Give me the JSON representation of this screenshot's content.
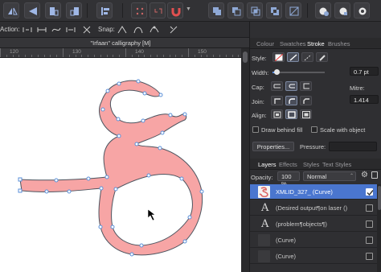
{
  "document": {
    "title": "\"Irfaan\" calligraphy [M]"
  },
  "context_toolbar": {
    "action_label": "Action:",
    "snap_label": "Snap:"
  },
  "ruler": {
    "labels": [
      "120",
      "130",
      "140",
      "150"
    ]
  },
  "panel": {
    "tabs": [
      "Colour",
      "Swatches",
      "Stroke",
      "Brushes"
    ],
    "active_tab": "Stroke",
    "style_label": "Style:",
    "width_label": "Width:",
    "width_value": "0.7 pt",
    "width_fraction": 0.08,
    "cap_label": "Cap:",
    "join_label": "Join:",
    "mitre_label": "Mitre:",
    "mitre_value": "1.414",
    "align_label": "Align:",
    "draw_behind_fill": "Draw behind fill",
    "scale_with_object": "Scale with object",
    "properties_button": "Properties...",
    "pressure_label": "Pressure:"
  },
  "layers_panel": {
    "tabs": [
      "Layers",
      "Effects",
      "Styles",
      "Text Styles"
    ],
    "active_tab": "Layers",
    "opacity_label": "Opacity:",
    "opacity_value": "100 %",
    "blend_mode": "Normal",
    "rows": [
      {
        "name": "XMLID_327_ (Curve)",
        "selected": true,
        "icon": "curve-thumb",
        "checked": true
      },
      {
        "name": "(Desired output¶on laser ()",
        "selected": false,
        "icon": "text-A",
        "checked": false
      },
      {
        "name": "(problem¶objects¶)",
        "selected": false,
        "icon": "text-A",
        "checked": false
      },
      {
        "name": "(Curve)",
        "selected": false,
        "icon": "blank",
        "checked": false
      },
      {
        "name": "(Curve)",
        "selected": false,
        "icon": "blank",
        "checked": false
      }
    ]
  },
  "colors": {
    "shape_fill": "#f7a5a5",
    "shape_stroke": "#4d5560",
    "selection_blue": "#4a76cf",
    "node_color": "#5a8fd8"
  }
}
